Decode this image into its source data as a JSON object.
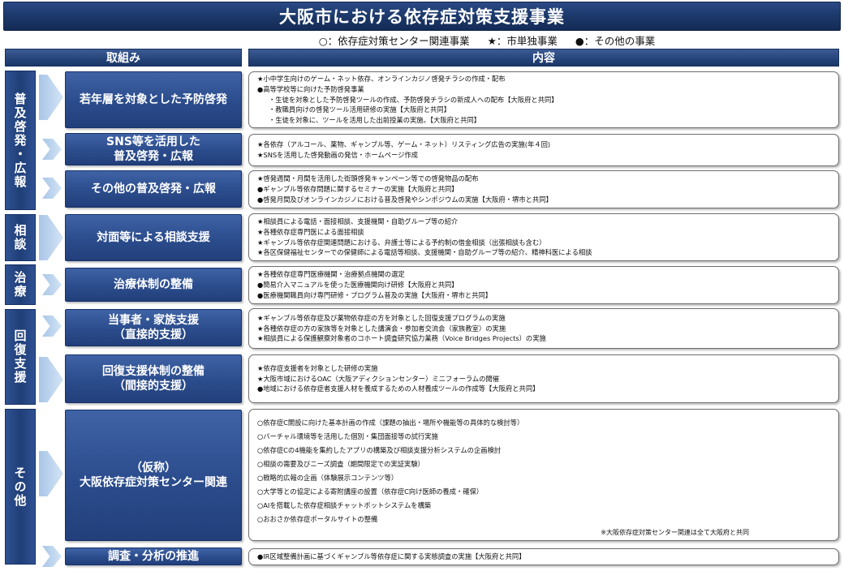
{
  "title": "大阪市における依存症対策支援事業",
  "legend": [
    "○：依存症対策センター関連事業",
    "★：市単独事業",
    "●：その他の事業"
  ],
  "headers": {
    "left": "取組み",
    "right": "内容"
  },
  "categories": {
    "fukyu": "普及啓発・広報",
    "sodan": "相談",
    "chiryo": "治療",
    "kaifuku": "回復支援",
    "sonota": "その他"
  },
  "items": {
    "youth": [
      "若年層を対象とした予防啓発"
    ],
    "sns": [
      "SNS等を活用した",
      "普及啓発・広報"
    ],
    "other_pr": [
      "その他の普及啓発・広報"
    ],
    "consult": [
      "対面等による相談支援"
    ],
    "treatment": [
      "治療体制の整備"
    ],
    "direct": [
      "当事者・家族支援",
      "（直接的支援）"
    ],
    "indirect": [
      "回復支援体制の整備",
      "（間接的支援）"
    ],
    "center": [
      "（仮称）",
      "大阪依存症対策センター関連"
    ],
    "research": [
      "調査・分析の推進"
    ]
  },
  "contents": {
    "youth": [
      "★小中学生向けのゲーム・ネット依存、オンラインカジノ啓発チラシの作成・配布",
      "●高等学校等に向けた予防啓発事業",
      "・生徒を対象とした予防啓発ツールの作成、予防啓発チラシの新成人への配布【大阪府と共同】",
      "・教職員向けの啓発ツール活用研修の実施【大阪府と共同】",
      "・生徒を対象に、ツールを活用した出前授業の実施。【大阪府と共同】"
    ],
    "sns": [
      "★各依存（アルコール、薬物、ギャンブル等、ゲーム・ネット）リスティング広告の実施(年４回)",
      "★SNSを活用した啓発動画の発信・ホームページ作成"
    ],
    "other_pr": [
      "★啓発週間・月間を活用した街頭啓発キャンペーン等での啓発物品の配布",
      "●ギャンブル等依存問題に関するセミナーの実施【大阪府と共同】",
      "●啓発月間及びオンラインカジノにおける普及啓発やシンポジウムの実施【大阪府・堺市と共同】"
    ],
    "consult": [
      "★相談員による電話・面接相談、支援機関・自助グループ等の紹介",
      "★各種依存症専門医による面接相談",
      "★ギャンブル等依存症関連問題における、弁護士等による予約制の借金相談（出張相談も含む）",
      "★各区保健福祉センターでの保健師による電話等相談、支援機関・自助グループ等の紹介、精神科医による相談"
    ],
    "treatment": [
      "★各種依存症専門医療機関・治療拠点機関の選定",
      "●簡易介入マニュアルを使った医療機関向け研修【大阪府と共同】",
      "●医療機関職員向け専門研修・プログラム普及の実施【大阪府・堺市と共同】"
    ],
    "direct": [
      "★ギャンブル等依存症及び薬物依存症の方を対象とした回復支援プログラムの実施",
      "★各種依存症の方の家族等を対象とした講演会・参加者交流会（家族教室）の実施",
      "★相談員による保護観察対象者のコホート調査研究協力業務（Voice Bridges Projects）の実施"
    ],
    "indirect": [
      "★依存症支援者を対象とした研修の実施",
      "★大阪市域におけるOAC（大阪アディクションセンター）ミニフォーラムの開催",
      "●地域における依存症者支援人材を養成するための人材養成ツールの作成等【大阪府と共同】"
    ],
    "center": [
      "○依存症C開設に向けた基本計画の作成（課題の抽出・場所や機能等の具体的な検討等）",
      "○バーチャル環境等を活用した個別・集団面接等の試行実施",
      "○依存症Cの4機能を集約したアプリの構築及び相談支援分析システムの企画検討",
      "○相談の需要及びニーズ調査（期間限定での実証実験）",
      "○戦略的広報の企画（体験展示コンテンツ等）",
      "○大学等との協定による寄附講座の設置（依存症C向け医師の養成・確保）",
      "○AIを搭載した依存症相談チャットボットシステムを構築",
      "○おおさか依存症ポータルサイトの整備"
    ],
    "center_note": "※大阪依存症対策センター関連は全て大阪府と共同",
    "research": [
      "●IR区域整備計画に基づくギャンブル等依存症に関する実態調査の実施【大阪府と共同】"
    ]
  }
}
